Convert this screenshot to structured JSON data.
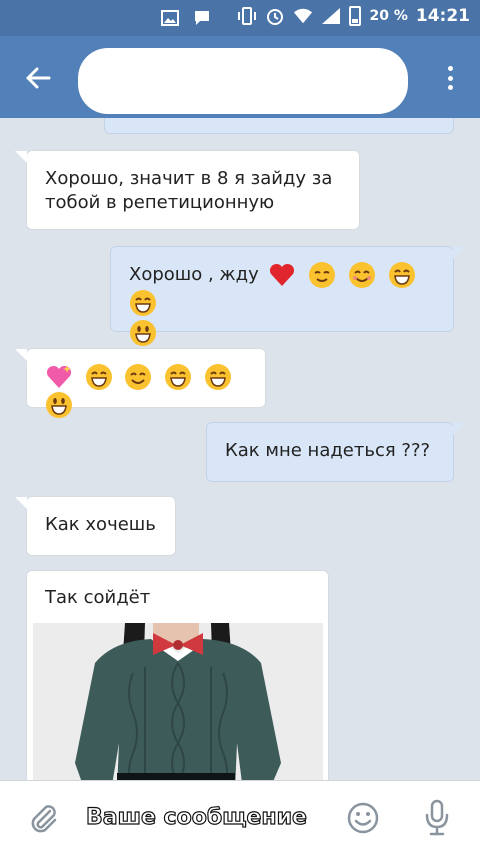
{
  "status_bar": {
    "battery": "20 %",
    "time": "14:21"
  },
  "header": {
    "title": ""
  },
  "messages": [
    {
      "side": "in",
      "text": "Хорошо, значит в 8 я зайду за тобой в репетиционную"
    },
    {
      "side": "out",
      "text": "Хорошо , жду"
    },
    {
      "side": "out",
      "text": "Как мне надеться ???"
    },
    {
      "side": "in",
      "text": "Как хочешь"
    },
    {
      "side": "in",
      "text": "Так сойдёт"
    }
  ],
  "input": {
    "placeholder": "Ваше сообщение"
  },
  "colors": {
    "header": "#5181b8",
    "outgoing_bubble": "#d9e6f7",
    "incoming_bubble": "#ffffff",
    "chat_bg": "#dde3ea"
  }
}
